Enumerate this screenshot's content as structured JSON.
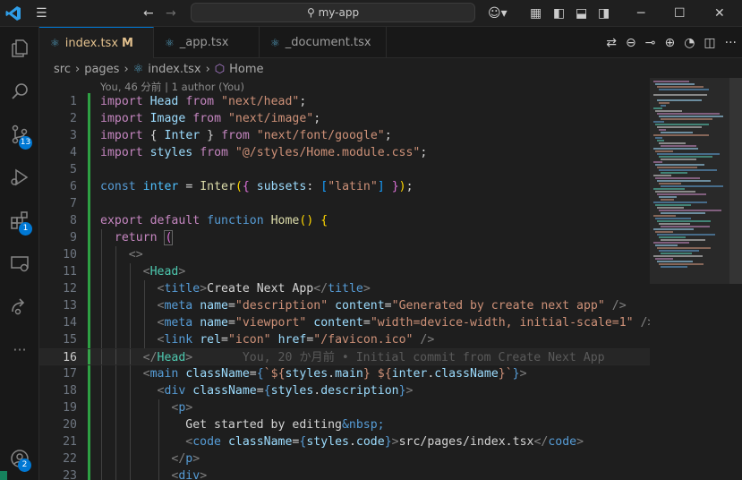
{
  "titlebar": {
    "search_text": "my-app"
  },
  "activity": {
    "scm_badge": "13",
    "extensions_badge": "1",
    "accounts_badge": "2"
  },
  "tabs": [
    {
      "label": "index.tsx",
      "modified": "M"
    },
    {
      "label": "_app.tsx"
    },
    {
      "label": "_document.tsx"
    }
  ],
  "breadcrumb": {
    "items": [
      "src",
      "pages",
      "index.tsx",
      "Home"
    ]
  },
  "codelens": "You, 46 分前 | 1 author (You)",
  "blame_line_16": "You, 20 か月前 • Initial commit from Create Next App",
  "line_numbers": [
    "1",
    "2",
    "3",
    "4",
    "5",
    "6",
    "7",
    "8",
    "9",
    "10",
    "11",
    "12",
    "13",
    "14",
    "15",
    "16",
    "17",
    "18",
    "19",
    "20",
    "21",
    "22",
    "23"
  ],
  "code": {
    "l1": [
      "import",
      "Head",
      "from",
      "\"next/head\"",
      ";"
    ],
    "l2": [
      "import",
      "Image",
      "from",
      "\"next/image\"",
      ";"
    ],
    "l3": [
      "import",
      "{",
      "Inter",
      "}",
      "from",
      "\"next/font/google\"",
      ";"
    ],
    "l4": [
      "import",
      "styles",
      "from",
      "\"@/styles/Home.module.css\"",
      ";"
    ],
    "l6": [
      "const",
      "inter",
      "=",
      "Inter",
      "(",
      "{",
      "subsets",
      ":",
      "[",
      "\"latin\"",
      "]",
      "}",
      ")",
      ";"
    ],
    "l8": [
      "export",
      "default",
      "function",
      "Home",
      "(",
      ")",
      "{"
    ],
    "l9": [
      "return",
      "("
    ],
    "l10": [
      "<>"
    ],
    "l11": [
      "<",
      "Head",
      ">"
    ],
    "l12": [
      "<",
      "title",
      ">",
      "Create Next App",
      "</",
      "title",
      ">"
    ],
    "l13": [
      "<",
      "meta",
      "name",
      "=",
      "\"description\"",
      "content",
      "=",
      "\"Generated by create next app\"",
      "/>"
    ],
    "l14": [
      "<",
      "meta",
      "name",
      "=",
      "\"viewport\"",
      "content",
      "=",
      "\"width=device-width, initial-scale=1\"",
      "/>"
    ],
    "l15": [
      "<",
      "link",
      "rel",
      "=",
      "\"icon\"",
      "href",
      "=",
      "\"/favicon.ico\"",
      "/>"
    ],
    "l16": [
      "</",
      "Head",
      ">"
    ],
    "l17": [
      "<",
      "main",
      "className",
      "=",
      "{",
      "`${",
      "styles",
      ".",
      "main",
      "} ${",
      "inter",
      ".",
      "className",
      "}`",
      "}",
      ">"
    ],
    "l18": [
      "<",
      "div",
      "className",
      "=",
      "{",
      "styles",
      ".",
      "description",
      "}",
      ">"
    ],
    "l19": [
      "<",
      "p",
      ">"
    ],
    "l20": [
      "Get started by editing",
      "&nbsp;"
    ],
    "l21": [
      "<",
      "code",
      "className",
      "=",
      "{",
      "styles",
      ".",
      "code",
      "}",
      ">",
      "src/pages/index.tsx",
      "</",
      "code",
      ">"
    ],
    "l22": [
      "</",
      "p",
      ">"
    ],
    "l23": [
      "<",
      "div",
      ">"
    ]
  }
}
